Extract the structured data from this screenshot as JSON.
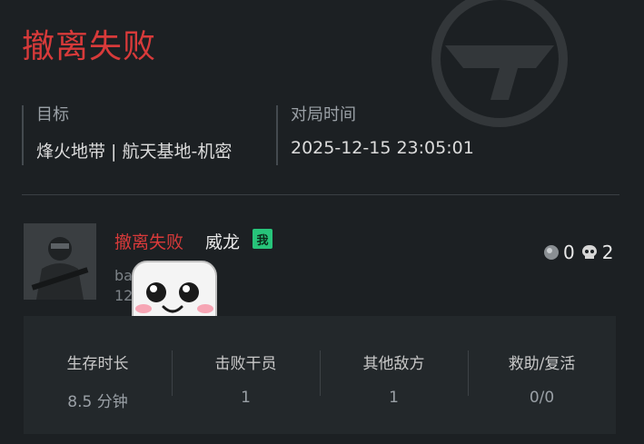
{
  "header": {
    "title": "撤离失败"
  },
  "info": {
    "target_label": "目标",
    "target_value": "烽火地带 | 航天基地-机密",
    "time_label": "对局时间",
    "time_value": "2025-12-15 23:05:01"
  },
  "player": {
    "result": "撤离失败",
    "name": "威龙",
    "me_badge": "我",
    "sub1": "ba",
    "sub2": "12",
    "counters": [
      {
        "icon": "coin-icon",
        "value": "0"
      },
      {
        "icon": "skull-icon",
        "value": "2"
      }
    ]
  },
  "stats": [
    {
      "label": "生存时长",
      "value": "8.5 分钟"
    },
    {
      "label": "击败干员",
      "value": "1"
    },
    {
      "label": "其他敌方",
      "value": "1"
    },
    {
      "label": "救助/复活",
      "value": "0/0"
    }
  ],
  "colors": {
    "accent_red": "#d83a3a",
    "me_badge_green": "#27c47a",
    "background": "#1c2023"
  }
}
